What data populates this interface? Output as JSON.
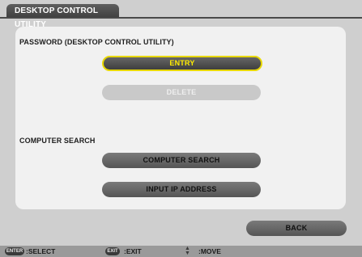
{
  "window": {
    "title": "DESKTOP CONTROL UTILITY"
  },
  "password_section": {
    "label": "PASSWORD (DESKTOP CONTROL UTILITY)",
    "entry_label": "ENTRY",
    "delete_label": "DELETE"
  },
  "search_section": {
    "label": "COMPUTER SEARCH",
    "computer_search_label": "COMPUTER SEARCH",
    "input_ip_label": "INPUT IP ADDRESS"
  },
  "back_label": "BACK",
  "footer": {
    "enter_key": "ENTER",
    "enter_text": ":SELECT",
    "exit_key": "EXIT",
    "exit_text": ":EXIT",
    "move_icon": "up-down-arrow-icon",
    "move_text": ":MOVE"
  },
  "colors": {
    "selected_outline": "#e8d800",
    "selected_text": "#ffec00",
    "background": "#cfcfcf",
    "panel": "#f1f1f1"
  }
}
